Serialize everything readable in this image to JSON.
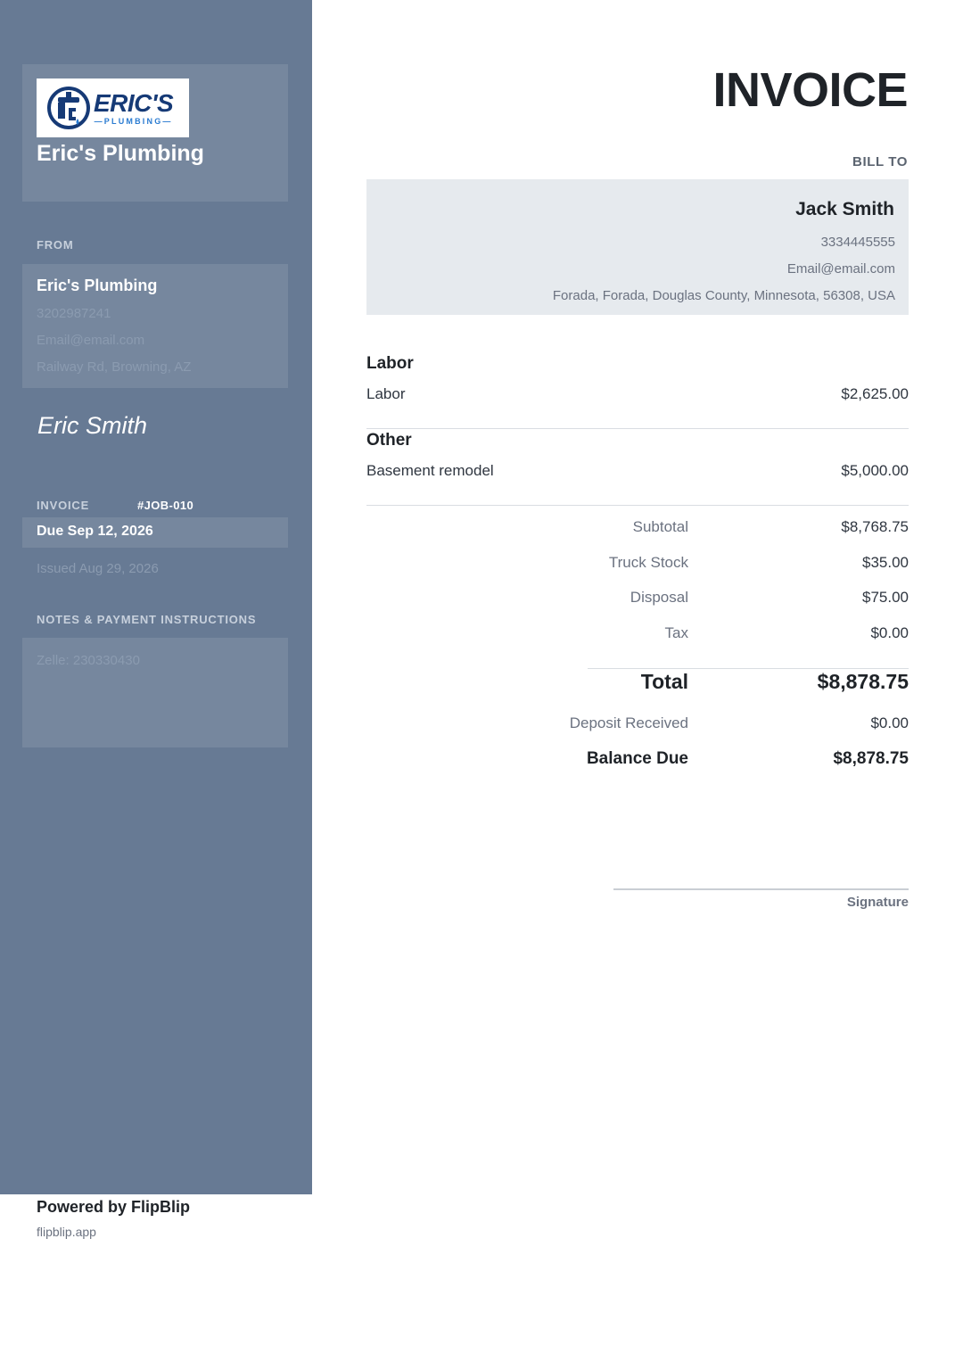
{
  "company": {
    "logo": {
      "name": "ERIC'S",
      "sub": "—PLUMBING—"
    },
    "name": "Eric's Plumbing"
  },
  "from": {
    "label": "FROM",
    "name": "Eric's Plumbing",
    "phone": "3202987241",
    "email": "Email@email.com",
    "address": "Railway Rd, Browning, AZ"
  },
  "sender_signature": "Eric Smith",
  "invoice": {
    "label": "INVOICE",
    "number": "#JOB-010",
    "due": "Due Sep 12, 2026",
    "issued": "Issued Aug 29, 2026"
  },
  "notes": {
    "label": "NOTES & PAYMENT INSTRUCTIONS",
    "text": "Zelle: 230330430"
  },
  "footer": {
    "powered": "Powered by FlipBlip",
    "url": "flipblip.app"
  },
  "title": "INVOICE",
  "bill_to": {
    "label": "BILL TO",
    "name": "Jack Smith",
    "phone": "3334445555",
    "email": "Email@email.com",
    "address": "Forada, Forada, Douglas County, Minnesota, 56308, USA"
  },
  "sections": [
    {
      "title": "Labor",
      "items": [
        {
          "description": "Labor",
          "amount": "$2,625.00"
        }
      ]
    },
    {
      "title": "Other",
      "items": [
        {
          "description": "Basement remodel",
          "amount": "$5,000.00"
        }
      ]
    }
  ],
  "summary": {
    "subtotal": {
      "label": "Subtotal",
      "value": "$8,768.75"
    },
    "truck_stock": {
      "label": "Truck Stock",
      "value": "$35.00"
    },
    "disposal": {
      "label": "Disposal",
      "value": "$75.00"
    },
    "tax": {
      "label": "Tax",
      "value": "$0.00"
    },
    "total": {
      "label": "Total",
      "value": "$8,878.75"
    },
    "deposit": {
      "label": "Deposit Received",
      "value": "$0.00"
    },
    "balance": {
      "label": "Balance Due",
      "value": "$8,878.75"
    }
  },
  "signature_label": "Signature",
  "colors": {
    "sidebar": "#677a94",
    "bill_box": "#e6eaee",
    "logo_navy": "#163a76",
    "logo_blue": "#2a7bd1"
  }
}
